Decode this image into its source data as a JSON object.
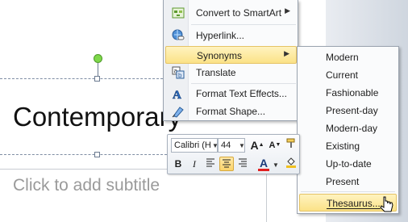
{
  "slide": {
    "title_text": "Contemporary",
    "subtitle_placeholder": "Click to add subtitle"
  },
  "context_menu": {
    "items": [
      {
        "label": "Convert to SmartArt",
        "icon": "smartart-icon",
        "has_submenu": true
      },
      {
        "label": "Hyperlink...",
        "icon": "hyperlink-icon",
        "has_submenu": false
      },
      {
        "label": "Synonyms",
        "icon": "",
        "has_submenu": true,
        "highlighted": true
      },
      {
        "label": "Translate",
        "icon": "translate-icon",
        "has_submenu": false
      },
      {
        "label": "Format Text Effects...",
        "icon": "text-effects-icon",
        "has_submenu": false
      },
      {
        "label": "Format Shape...",
        "icon": "format-shape-icon",
        "has_submenu": false
      }
    ]
  },
  "synonyms_submenu": {
    "items": [
      "Modern",
      "Current",
      "Fashionable",
      "Present-day",
      "Modern-day",
      "Existing",
      "Up-to-date",
      "Present"
    ],
    "thesaurus_label": "Thesaurus..."
  },
  "mini_toolbar": {
    "font_name": "Calibri (H",
    "font_size": "44",
    "grow_font": "A",
    "shrink_font": "A",
    "bold": "B",
    "italic": "I",
    "font_color_label": "A"
  },
  "colors": {
    "highlight": "#fbe287",
    "font_color_bar": "#e02020",
    "rotation_handle": "#7ed84a"
  }
}
